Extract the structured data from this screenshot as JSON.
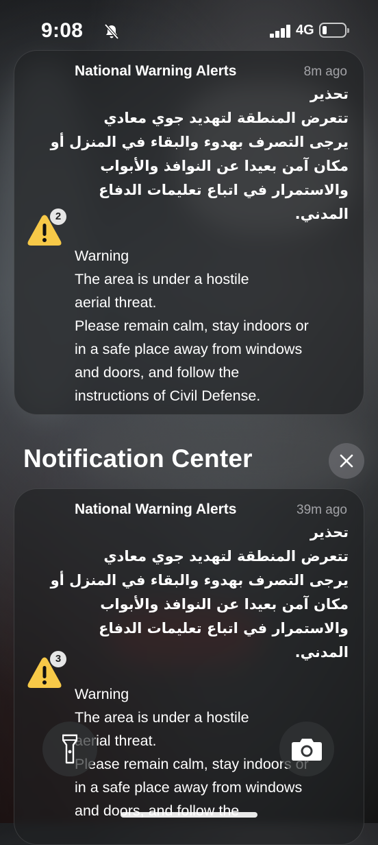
{
  "status_bar": {
    "time": "9:08",
    "network": "4G",
    "silent_icon": "bell-slash-icon",
    "signal_icon": "cellular-signal-icon",
    "battery_icon": "battery-low-icon"
  },
  "notification_center": {
    "title": "Notification Center",
    "close_icon": "close-icon"
  },
  "notifications": [
    {
      "app": "National Warning Alerts",
      "time_ago": "8m ago",
      "badge": "2",
      "icon": "warning-triangle-icon",
      "arabic_lines": [
        "تحذير",
        "تتعرض المنطقة لتهديد جوي معادي",
        "يرجى التصرف بهدوء والبقاء في المنزل أو",
        "مكان آمن بعيدا عن النوافذ والأبواب",
        "والاستمرار في اتباع تعليمات الدفاع",
        "المدني."
      ],
      "english_lines": [
        "Warning",
        "The area is under a hostile",
        "aerial threat.",
        "Please remain calm, stay indoors or",
        "in a safe place away from windows",
        "and doors, and follow the",
        "instructions of Civil Defense."
      ]
    },
    {
      "app": "National Warning Alerts",
      "time_ago": "39m ago",
      "badge": "3",
      "icon": "warning-triangle-icon",
      "arabic_lines": [
        "تحذير",
        "تتعرض المنطقة لتهديد جوي معادي",
        "يرجى التصرف بهدوء والبقاء في المنزل أو",
        "مكان آمن بعيدا عن النوافذ والأبواب",
        "والاستمرار في اتباع تعليمات الدفاع",
        "المدني."
      ],
      "english_lines": [
        "Warning",
        "The area is under a hostile",
        "aerial threat.",
        "Please remain calm, stay indoors or",
        "in a safe place away from windows",
        "and doors, and follow the"
      ]
    }
  ],
  "quick_actions": {
    "flashlight_icon": "flashlight-icon",
    "camera_icon": "camera-icon"
  },
  "colors": {
    "card_bg": "#1e2022",
    "warning_yellow": "#f7c948",
    "secondary_text": "#a8a8ad"
  }
}
